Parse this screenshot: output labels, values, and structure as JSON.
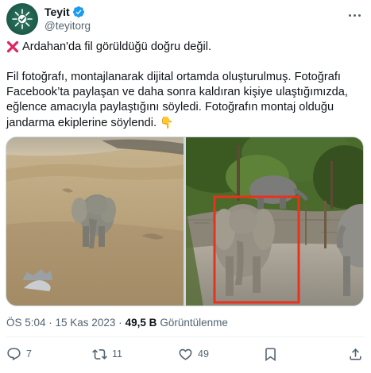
{
  "author": {
    "display_name": "Teyit",
    "handle": "@teyitorg",
    "verified_icon": "verified-badge-icon",
    "verified_color": "#1d9bf0"
  },
  "tweet": {
    "line1": "Ardahan'da fil görüldüğü doğru değil.",
    "line1_icon": "cross-mark-icon",
    "line1_icon_color": "#e0245e",
    "paragraph2": "Fil fotoğrafı, montajlanarak dijital ortamda oluşturulmuş. Fotoğrafı Facebook’ta paylaşan ve daha sonra kaldıran kişiye ulaştığımızda, eğlence amacıyla paylaştığını söyledi. Fotoğrafın montaj olduğu jandarma ekiplerine söylendi.",
    "paragraph2_emoji": "👇"
  },
  "media": {
    "left_photo": "elephant-on-grassy-hill-photo",
    "right_photo": "elephants-in-zoo-enclosure-photo",
    "highlight_color": "#e8321e"
  },
  "meta": {
    "timestamp": "ÖS 5:04 · 15 Kas 2023 ·",
    "views_count": "49,5 B",
    "views_label": "Görüntülenme"
  },
  "actions": {
    "replies": "7",
    "retweets": "11",
    "likes": "49",
    "bookmark_icon": "bookmark-icon",
    "share_icon": "share-icon"
  }
}
